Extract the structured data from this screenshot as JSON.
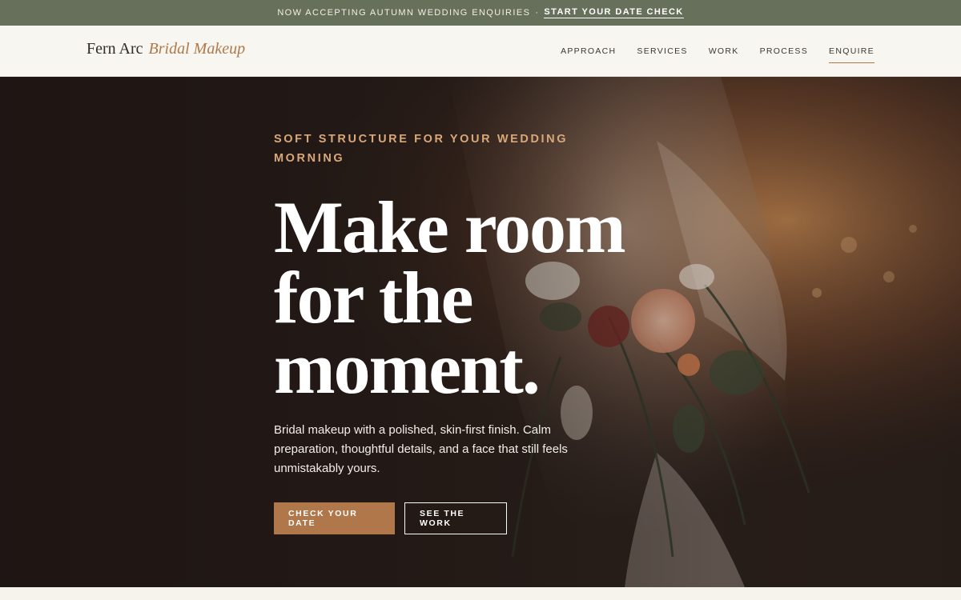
{
  "announcement": {
    "text": "NOW ACCEPTING AUTUMN WEDDING ENQUIRIES",
    "separator": "·",
    "link_label": "START YOUR DATE CHECK"
  },
  "brand": {
    "name": "Fern Arc",
    "tagline": "Bridal Makeup"
  },
  "nav": {
    "items": [
      {
        "label": "APPROACH"
      },
      {
        "label": "SERVICES"
      },
      {
        "label": "WORK"
      },
      {
        "label": "PROCESS"
      },
      {
        "label": "ENQUIRE",
        "active": true
      }
    ]
  },
  "hero": {
    "eyebrow": "SOFT STRUCTURE FOR YOUR WEDDING MORNING",
    "headline": "Make room for the moment.",
    "lede": "Bridal makeup with a polished, skin-first finish. Calm preparation, thoughtful details, and a face that still feels unmistakably yours.",
    "primary_cta": "CHECK YOUR DATE",
    "secondary_cta": "SEE THE WORK",
    "image_icon": "bride-bouquet-photo"
  },
  "colors": {
    "announcement_bg": "#67705a",
    "accent": "#b0784a",
    "eyebrow": "#d8a87a",
    "header_bg": "#f8f6f1"
  }
}
